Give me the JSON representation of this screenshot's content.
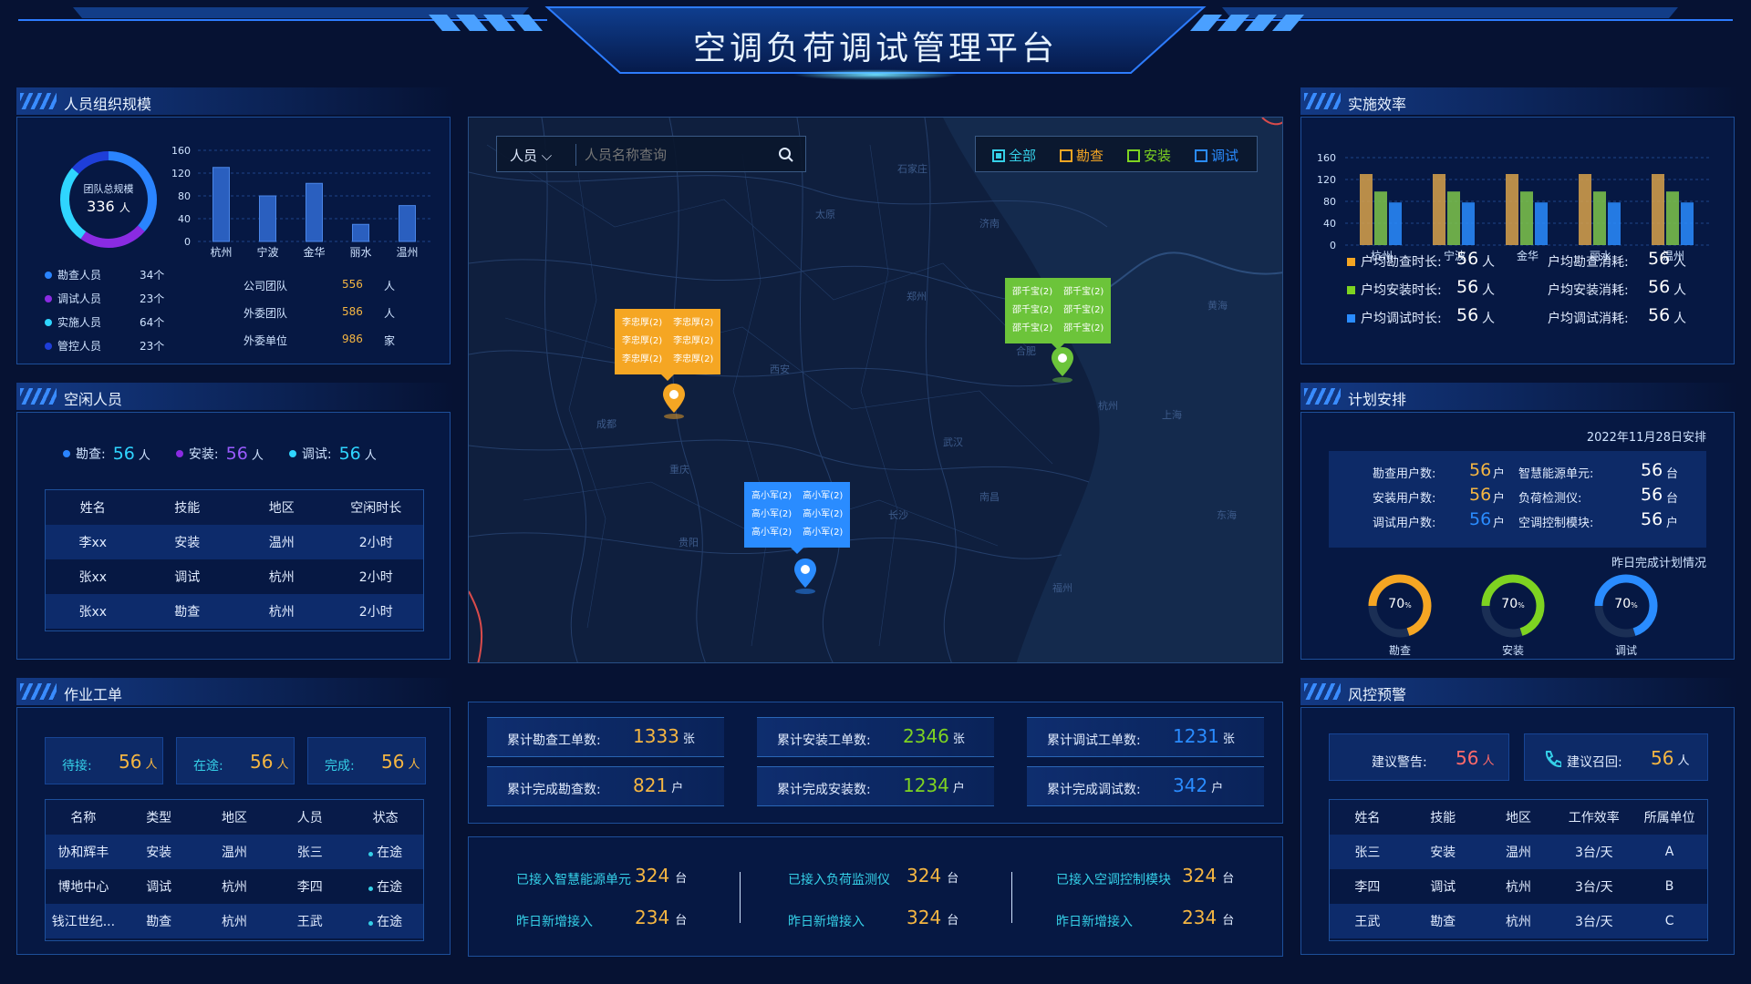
{
  "header": {
    "title": "空调负荷调试管理平台"
  },
  "team": {
    "title": "人员组织规模",
    "ring_label": "团队总规模",
    "ring_value": "336",
    "ring_unit": "人",
    "bars": {
      "categories": [
        "杭州",
        "宁波",
        "金华",
        "丽水",
        "温州"
      ],
      "values": [
        130,
        80,
        102,
        30,
        63
      ],
      "ylim": [
        0,
        160
      ],
      "ticks": [
        "160",
        "120",
        "80",
        "40",
        "0"
      ]
    },
    "legend": [
      {
        "label": "勘查人员",
        "value": "34个",
        "color": "#2a84ff"
      },
      {
        "label": "调试人员",
        "value": "23个",
        "color": "#8a2be2"
      },
      {
        "label": "实施人员",
        "value": "64个",
        "color": "#2fd5ff"
      },
      {
        "label": "管控人员",
        "value": "23个",
        "color": "#1e3ed8"
      }
    ],
    "groups": [
      {
        "label": "公司团队",
        "value": "556",
        "unit": "人"
      },
      {
        "label": "外委团队",
        "value": "586",
        "unit": "人"
      },
      {
        "label": "外委单位",
        "value": "986",
        "unit": "家"
      }
    ]
  },
  "idle": {
    "title": "空闲人员",
    "counts": [
      {
        "label": "勘查:",
        "value": "56",
        "unit": "人",
        "color": "#2a84ff"
      },
      {
        "label": "安装:",
        "value": "56",
        "unit": "人",
        "color": "#8a2be2"
      },
      {
        "label": "调试:",
        "value": "56",
        "unit": "人",
        "color": "#2fd5ff"
      }
    ],
    "headers": [
      "姓名",
      "技能",
      "地区",
      "空闲时长"
    ],
    "rows": [
      [
        "李xx",
        "安装",
        "温州",
        "2小时"
      ],
      [
        "张xx",
        "调试",
        "杭州",
        "2小时"
      ],
      [
        "张xx",
        "勘查",
        "杭州",
        "2小时"
      ]
    ]
  },
  "orders": {
    "title": "作业工单",
    "status": [
      {
        "label": "待接:",
        "value": "56",
        "unit": "人"
      },
      {
        "label": "在途:",
        "value": "56",
        "unit": "人"
      },
      {
        "label": "完成:",
        "value": "56",
        "unit": "人"
      }
    ],
    "headers": [
      "名称",
      "类型",
      "地区",
      "人员",
      "状态"
    ],
    "rows": [
      [
        "协和辉丰",
        "安装",
        "温州",
        "张三",
        "在途"
      ],
      [
        "博地中心",
        "调试",
        "杭州",
        "李四",
        "在途"
      ],
      [
        "钱江世纪...",
        "勘查",
        "杭州",
        "王武",
        "在途"
      ]
    ]
  },
  "map": {
    "search_type": "人员",
    "search_placeholder": "人员名称查询",
    "filters": [
      {
        "label": "全部",
        "color": "#35d0e8",
        "checked": true
      },
      {
        "label": "勘查",
        "color": "#f5a623",
        "checked": false
      },
      {
        "label": "安装",
        "color": "#7ed321",
        "checked": false
      },
      {
        "label": "调试",
        "color": "#2a8cff",
        "checked": false
      }
    ],
    "popups": [
      {
        "color": "#f5a623",
        "names": [
          "李忠厚(2)",
          "李忠厚(2)",
          "李忠厚(2)",
          "李忠厚(2)",
          "李忠厚(2)",
          "李忠厚(2)"
        ]
      },
      {
        "color": "#6cc43a",
        "names": [
          "邵千宝(2)",
          "邵千宝(2)",
          "邵千宝(2)",
          "邵千宝(2)",
          "邵千宝(2)",
          "邵千宝(2)"
        ]
      },
      {
        "color": "#2a8cff",
        "names": [
          "高小军(2)",
          "高小军(2)",
          "高小军(2)",
          "高小军(2)",
          "高小军(2)",
          "高小军(2)"
        ]
      }
    ],
    "places": [
      "西安",
      "郑州",
      "武汉",
      "长沙",
      "南京",
      "上海",
      "杭州",
      "合肥",
      "济南",
      "石家庄",
      "太原",
      "南昌",
      "福州",
      "贵阳",
      "重庆",
      "成都",
      "黄海",
      "东海"
    ]
  },
  "totals": [
    {
      "label": "累计勘查工单数:",
      "value": "1333",
      "unit": "张",
      "color": "#f5b642"
    },
    {
      "label": "累计安装工单数:",
      "value": "2346",
      "unit": "张",
      "color": "#7ed321"
    },
    {
      "label": "累计调试工单数:",
      "value": "1231",
      "unit": "张",
      "color": "#2a8cff"
    },
    {
      "label": "累计完成勘查数:",
      "value": "821",
      "unit": "户",
      "color": "#f5b642"
    },
    {
      "label": "累计完成安装数:",
      "value": "1234",
      "unit": "户",
      "color": "#7ed321"
    },
    {
      "label": "累计完成调试数:",
      "value": "342",
      "unit": "户",
      "color": "#2a8cff"
    }
  ],
  "access": [
    {
      "label": "已接入智慧能源单元",
      "value": "324",
      "unit": "台",
      "sub_label": "昨日新增接入",
      "sub_value": "234",
      "sub_unit": "台"
    },
    {
      "label": "已接入负荷监测仪",
      "value": "324",
      "unit": "台",
      "sub_label": "昨日新增接入",
      "sub_value": "324",
      "sub_unit": "台"
    },
    {
      "label": "已接入空调控制模块",
      "value": "324",
      "unit": "台",
      "sub_label": "昨日新增接入",
      "sub_value": "234",
      "sub_unit": "台"
    }
  ],
  "efficiency": {
    "title": "实施效率",
    "chart_data": {
      "type": "bar",
      "categories": [
        "杭州",
        "宁波",
        "金华",
        "丽水",
        "温州"
      ],
      "ylim": [
        0,
        160
      ],
      "ticks": [
        "160",
        "120",
        "80",
        "40",
        "0"
      ],
      "series": [
        {
          "color": "#d9a24a",
          "values": [
            130,
            130,
            130,
            130,
            130
          ]
        },
        {
          "color": "#7fc64a",
          "values": [
            98,
            98,
            98,
            98,
            98
          ]
        },
        {
          "color": "#2a8cff",
          "values": [
            78,
            78,
            78,
            78,
            78
          ]
        }
      ]
    },
    "stats": [
      {
        "label": "户均勘查时长:",
        "value": "56",
        "unit": "人",
        "color": "#f5a623"
      },
      {
        "label": "户均安装时长:",
        "value": "56",
        "unit": "人",
        "color": "#7ed321"
      },
      {
        "label": "户均调试时长:",
        "value": "56",
        "unit": "人",
        "color": "#2a8cff"
      },
      {
        "label": "户均勘查消耗:",
        "value": "56",
        "unit": "人"
      },
      {
        "label": "户均安装消耗:",
        "value": "56",
        "unit": "人"
      },
      {
        "label": "户均调试消耗:",
        "value": "56",
        "unit": "人"
      }
    ]
  },
  "plan": {
    "title": "计划安排",
    "date": "2022年11月28日安排",
    "left": [
      {
        "label": "勘查用户数:",
        "value": "56",
        "unit": "户",
        "color": "#f5b642"
      },
      {
        "label": "安装用户数:",
        "value": "56",
        "unit": "户",
        "color": "#f5b642"
      },
      {
        "label": "调试用户数:",
        "value": "56",
        "unit": "户",
        "color": "#2a8cff"
      }
    ],
    "right": [
      {
        "label": "智慧能源单元:",
        "value": "56",
        "unit": "台"
      },
      {
        "label": "负荷检测仪:",
        "value": "56",
        "unit": "台"
      },
      {
        "label": "空调控制模块:",
        "value": "56",
        "unit": "户"
      }
    ],
    "yesterday": "昨日完成计划情况",
    "gauges": [
      {
        "label": "勘查",
        "value": "70",
        "unit": "%",
        "fraction": 0.7,
        "color": "#f5a623"
      },
      {
        "label": "安装",
        "value": "70",
        "unit": "%",
        "fraction": 0.7,
        "color": "#7ed321"
      },
      {
        "label": "调试",
        "value": "70",
        "unit": "%",
        "fraction": 0.7,
        "color": "#2a8cff"
      }
    ]
  },
  "risk": {
    "title": "风控预警",
    "warn_label": "建议警告:",
    "warn_value": "56",
    "warn_unit": "人",
    "recall_label": "建议召回:",
    "recall_value": "56",
    "recall_unit": "人",
    "headers": [
      "姓名",
      "技能",
      "地区",
      "工作效率",
      "所属单位"
    ],
    "rows": [
      [
        "张三",
        "安装",
        "温州",
        "3台/天",
        "A"
      ],
      [
        "李四",
        "调试",
        "杭州",
        "3台/天",
        "B"
      ],
      [
        "王武",
        "勘查",
        "杭州",
        "3台/天",
        "C"
      ]
    ]
  }
}
